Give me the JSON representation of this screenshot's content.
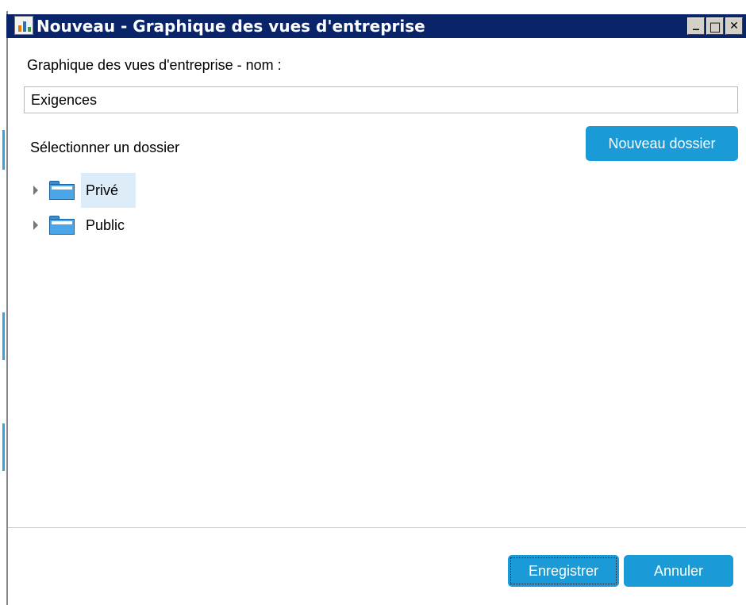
{
  "window": {
    "title": "Nouveau - Graphique des vues d'entreprise",
    "controls": {
      "minimize_label": "_",
      "maximize_label": "□",
      "close_label": "✕"
    }
  },
  "form": {
    "name_label": "Graphique des vues d'entreprise - nom :",
    "name_value": "Exigences",
    "folder_label": "Sélectionner un dossier",
    "new_folder_button": "Nouveau dossier"
  },
  "tree": {
    "items": [
      {
        "label": "Privé",
        "icon": "folder-icon",
        "selected": true
      },
      {
        "label": "Public",
        "icon": "folder-icon",
        "selected": false
      }
    ]
  },
  "footer": {
    "save_button": "Enregistrer",
    "cancel_button": "Annuler"
  },
  "colors": {
    "titlebar": "#0a246a",
    "accent_button": "#1a9ad6",
    "selected_row": "#dcecf8"
  }
}
